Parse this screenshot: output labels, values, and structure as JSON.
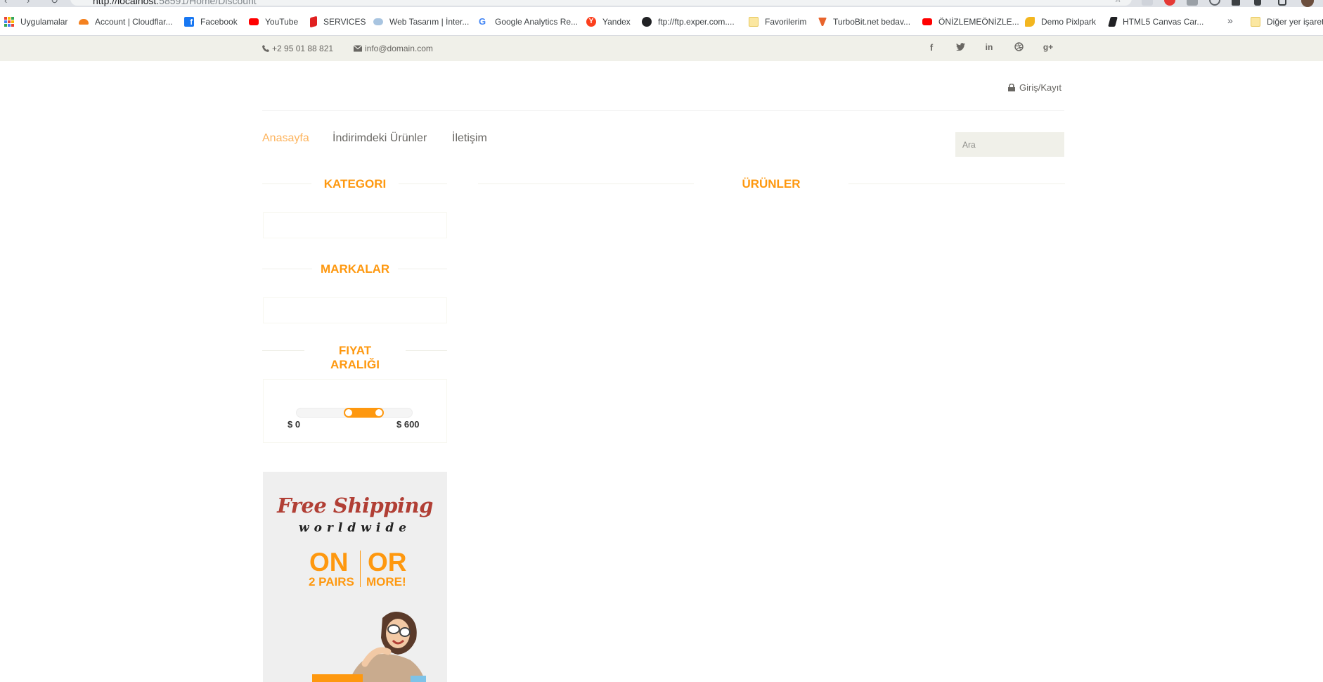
{
  "browser": {
    "url_host": "http://localhost:",
    "url_path": "58591/Home/Discount",
    "bookmarks": [
      {
        "label": "Uygulamalar",
        "icon": "apps-icon"
      },
      {
        "label": "Account | Cloudflar...",
        "icon": "cloudflare-icon"
      },
      {
        "label": "Facebook",
        "icon": "facebook-icon"
      },
      {
        "label": "YouTube",
        "icon": "youtube-icon"
      },
      {
        "label": "SERVICES",
        "icon": "services-icon"
      },
      {
        "label": "Web Tasarım | İnter...",
        "icon": "web-icon"
      },
      {
        "label": "Google Analytics Re...",
        "icon": "google-icon"
      },
      {
        "label": "Yandex",
        "icon": "yandex-icon"
      },
      {
        "label": "ftp://ftp.exper.com....",
        "icon": "globe-icon"
      },
      {
        "label": "Favorilerim",
        "icon": "folder-icon"
      },
      {
        "label": "TurboBit.net bedav...",
        "icon": "turbobit-icon"
      },
      {
        "label": "ÖNİZLEMEÖNİZLE...",
        "icon": "youtube-icon"
      },
      {
        "label": "Demo Pixlpark",
        "icon": "pixlpark-icon"
      },
      {
        "label": "HTML5 Canvas Car...",
        "icon": "canvas-icon"
      }
    ],
    "overflow": "»",
    "other_bookmarks": "Diğer yer işaret"
  },
  "topbar": {
    "phone": "+2 95 01 88 821",
    "email": "info@domain.com",
    "social": [
      "f",
      "t",
      "in",
      "d",
      "g+"
    ]
  },
  "header": {
    "login": "Giriş/Kayıt",
    "menu": [
      "Anasayfa",
      "İndirimdeki Ürünler",
      "İletişim"
    ],
    "search_placeholder": "Ara"
  },
  "sidebar": {
    "category_title": "KATEGORI",
    "brands_title": "MARKALAR",
    "price_title": "FIYAT ARALIĞI",
    "price_min": "$ 0",
    "price_max": "$ 600",
    "slider_low_fraction": 0.45,
    "slider_high_fraction": 0.71
  },
  "main": {
    "products_title": "ÜRÜNLER"
  },
  "ad": {
    "line1": "Free Shipping",
    "line2": "worldwide",
    "on": "ON",
    "or": "OR",
    "pairs": "2 PAIRS",
    "more": "MORE!"
  },
  "colors": {
    "accent": "#fe980f",
    "active_menu": "#fdb45e",
    "topbar_bg": "#f0f0e9",
    "ad_red": "#b13f35"
  }
}
